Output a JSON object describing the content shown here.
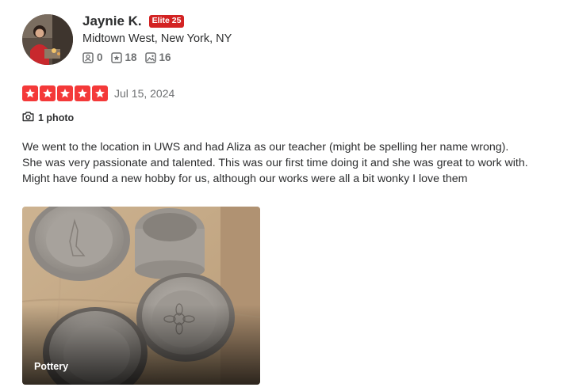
{
  "user": {
    "name": "Jaynie K.",
    "elite_badge": "Elite 25",
    "location": "Midtown West, New York, NY",
    "stats": {
      "friends": "0",
      "reviews": "18",
      "photos": "16"
    }
  },
  "review": {
    "rating": 5,
    "star_color": "#f43939",
    "date": "Jul 15, 2024",
    "photo_count_label": "1 photo",
    "text": "We went to the location in UWS and had Aliza as our teacher (might be spelling her name wrong). She was very passionate and talented. This was our first time doing it and she was great to work with. Might have found a new hobby for us, although our works were all a bit wonky I love them",
    "photo": {
      "caption": "Pottery"
    }
  },
  "icons": {
    "friends": "friends-icon",
    "reviews": "star-outline-icon",
    "photos": "image-icon",
    "camera": "camera-icon"
  }
}
